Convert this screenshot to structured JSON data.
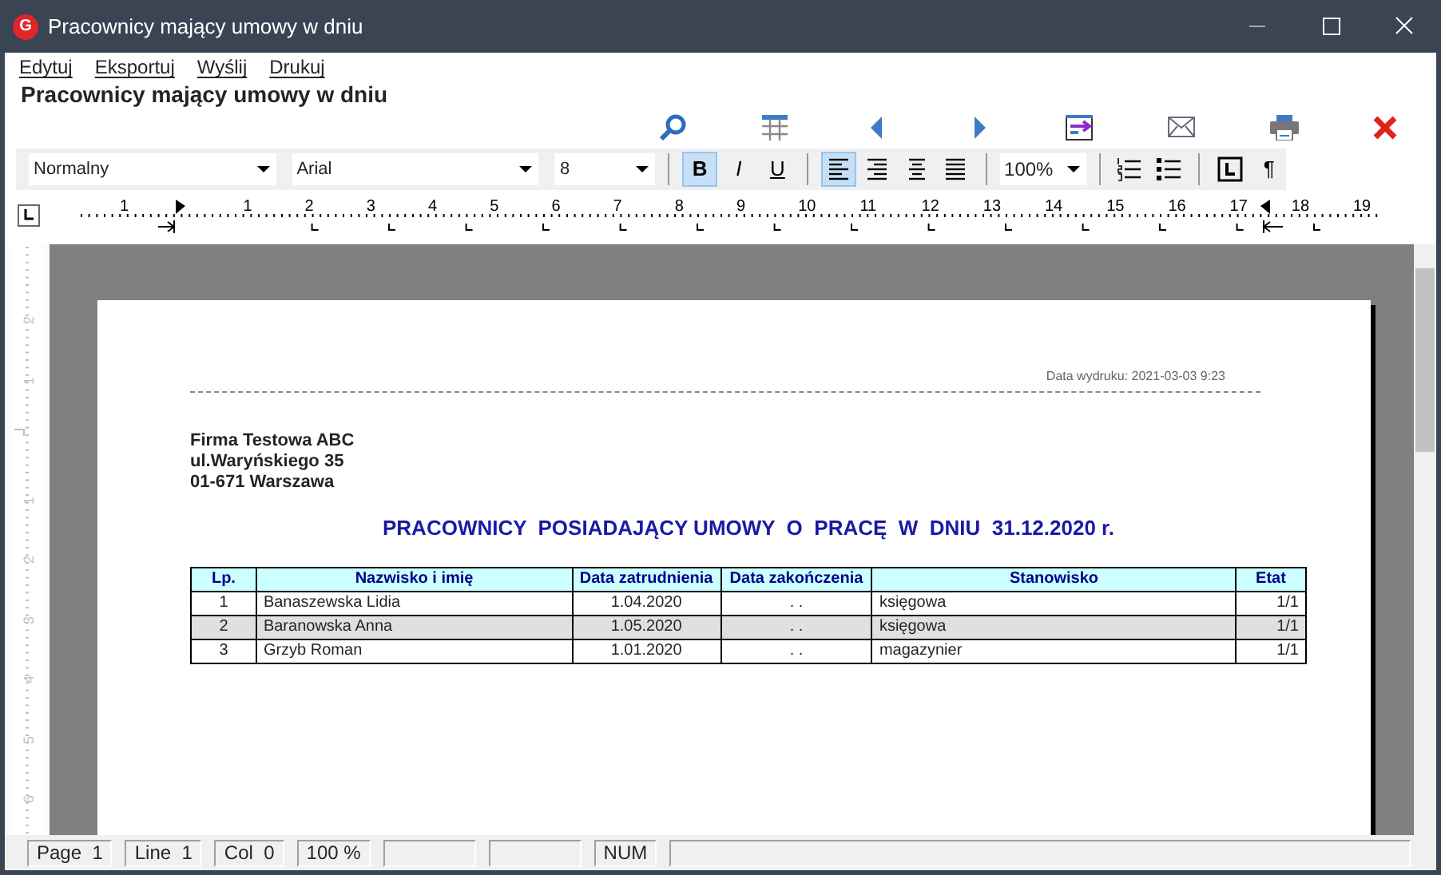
{
  "window": {
    "logo": "G",
    "title": "Pracownicy mający umowy w dniu"
  },
  "menu": [
    {
      "label": "Edytuj"
    },
    {
      "label": "Eksportuj"
    },
    {
      "label": "Wyślij"
    },
    {
      "label": "Drukuj"
    }
  ],
  "heading": "Pracownicy mający umowy w dniu",
  "toolbar": [
    {
      "kind": "search"
    },
    {
      "kind": "grid"
    },
    {
      "kind": "prev"
    },
    {
      "kind": "next"
    },
    {
      "kind": "export"
    },
    {
      "kind": "mail"
    },
    {
      "kind": "print"
    },
    {
      "kind": "close"
    }
  ],
  "format_bar": {
    "style": "Normalny",
    "font": "Arial",
    "size": "8",
    "zoom": "100%",
    "buttons": [
      {
        "kind": "bold",
        "label": "B",
        "selected": true
      },
      {
        "kind": "italic",
        "label": "I",
        "selected": false
      },
      {
        "kind": "underline",
        "label": "U",
        "selected": false
      },
      {
        "kind": "sep"
      },
      {
        "kind": "align-left",
        "selected": true
      },
      {
        "kind": "align-right",
        "selected": false
      },
      {
        "kind": "align-center",
        "selected": false
      },
      {
        "kind": "justify",
        "selected": false
      }
    ],
    "extra": [
      {
        "kind": "numbered-list"
      },
      {
        "kind": "bullet-list"
      },
      {
        "kind": "sep"
      },
      {
        "kind": "tab-box"
      },
      {
        "kind": "pilcrow",
        "label": "¶"
      }
    ]
  },
  "ruler": {
    "labels": [
      "1",
      "1",
      "2",
      "3",
      "4",
      "5",
      "6",
      "7",
      "8",
      "9",
      "10",
      "11",
      "12",
      "13",
      "14",
      "15",
      "16",
      "17",
      "18",
      "19"
    ],
    "vertical_labels": [
      "2",
      "1",
      "1",
      "2",
      "3",
      "4",
      "5",
      "6"
    ]
  },
  "document": {
    "print_date": "Data wydruku: 2021-03-03  9:23",
    "company": [
      "Firma Testowa ABC",
      "ul.Waryńskiego 35",
      "01-671 Warszawa"
    ],
    "title": "PRACOWNICY  POSIADAJĄCY UMOWY  O  PRACĘ  W  DNIU  31.12.2020 r.",
    "table": {
      "columns": [
        "Lp.",
        "Nazwisko i imię",
        "Data zatrudnienia",
        "Data zakończenia",
        "Stanowisko",
        "Etat"
      ],
      "rows": [
        {
          "shaded": false,
          "cells": [
            "1",
            "Banaszewska Lidia",
            "1.04.2020",
            ". .",
            "księgowa",
            "1/1"
          ]
        },
        {
          "shaded": true,
          "cells": [
            "2",
            "Baranowska Anna",
            "1.05.2020",
            ". .",
            "księgowa",
            "1/1"
          ]
        },
        {
          "shaded": false,
          "cells": [
            "3",
            "Grzyb Roman",
            "1.01.2020",
            ". .",
            "magazynier",
            "1/1"
          ]
        }
      ]
    }
  },
  "status_bar": [
    {
      "kind": "text",
      "text": "Page  1"
    },
    {
      "kind": "text",
      "text": "Line  1"
    },
    {
      "kind": "text",
      "text": "Col  0"
    },
    {
      "kind": "text",
      "text": "100 %"
    },
    {
      "kind": "blank"
    },
    {
      "kind": "blank"
    },
    {
      "kind": "text",
      "text": "NUM"
    },
    {
      "kind": "fill"
    }
  ]
}
